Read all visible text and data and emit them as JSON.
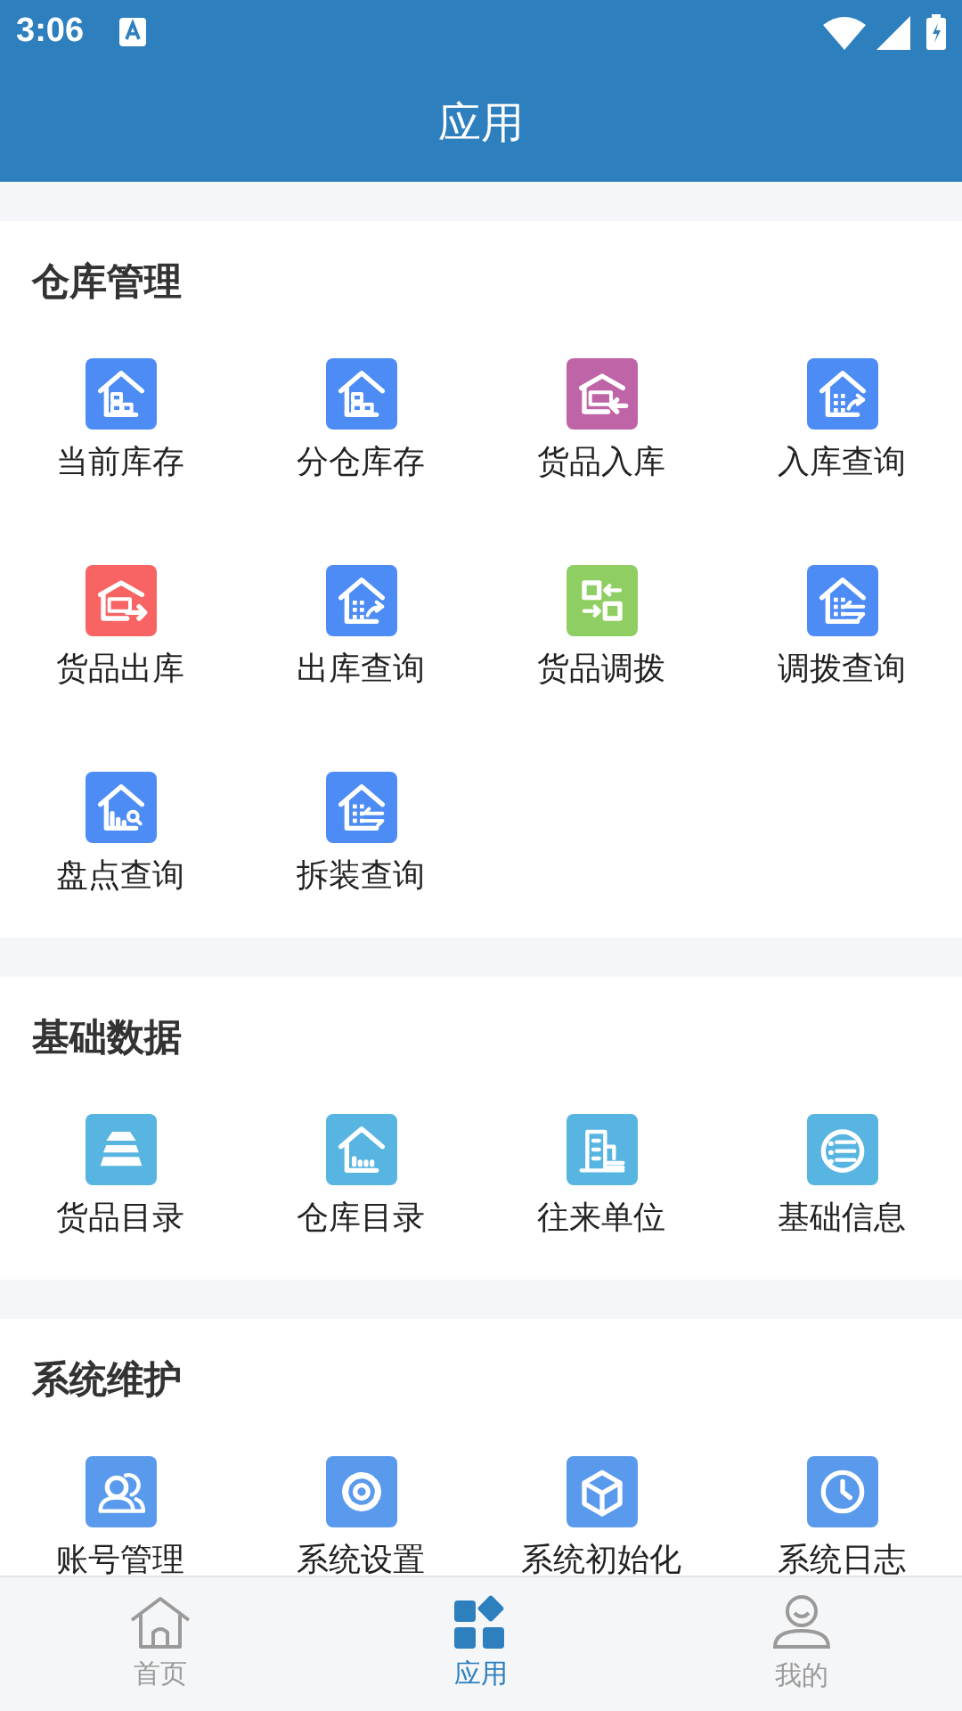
{
  "status_bar": {
    "time": "3:06"
  },
  "header": {
    "title": "应用"
  },
  "sections": [
    {
      "title": "仓库管理",
      "items": [
        {
          "label": "当前库存",
          "color": "#4d8cf5",
          "kind": "house-boxes"
        },
        {
          "label": "分仓库存",
          "color": "#4d8cf5",
          "kind": "house-boxes"
        },
        {
          "label": "货品入库",
          "color": "#bf64a6",
          "kind": "warehouse-in"
        },
        {
          "label": "入库查询",
          "color": "#4d8cf5",
          "kind": "house-grid-arrow"
        },
        {
          "label": "货品出库",
          "color": "#f86464",
          "kind": "warehouse-out"
        },
        {
          "label": "出库查询",
          "color": "#4d8cf5",
          "kind": "house-grid-arrow"
        },
        {
          "label": "货品调拨",
          "color": "#8fce62",
          "kind": "swap-squares"
        },
        {
          "label": "调拨查询",
          "color": "#4d8cf5",
          "kind": "house-swap"
        },
        {
          "label": "盘点查询",
          "color": "#4d8cf5",
          "kind": "house-search"
        },
        {
          "label": "拆装查询",
          "color": "#4d8cf5",
          "kind": "house-swap"
        }
      ]
    },
    {
      "title": "基础数据",
      "items": [
        {
          "label": "货品目录",
          "color": "#58b4e0",
          "kind": "layers"
        },
        {
          "label": "仓库目录",
          "color": "#58b4e0",
          "kind": "house-bars"
        },
        {
          "label": "往来单位",
          "color": "#58b4e0",
          "kind": "building"
        },
        {
          "label": "基础信息",
          "color": "#58b4e0",
          "kind": "list-circle"
        }
      ]
    },
    {
      "title": "系统维护",
      "items": [
        {
          "label": "账号管理",
          "color": "#5a9aec",
          "kind": "users"
        },
        {
          "label": "系统设置",
          "color": "#5a9aec",
          "kind": "gear"
        },
        {
          "label": "系统初始化",
          "color": "#5a9aec",
          "kind": "cube"
        },
        {
          "label": "系统日志",
          "color": "#5a9aec",
          "kind": "clock"
        }
      ]
    }
  ],
  "tabs": [
    {
      "label": "首页",
      "kind": "home",
      "selected": false
    },
    {
      "label": "应用",
      "kind": "apps",
      "selected": true
    },
    {
      "label": "我的",
      "kind": "user",
      "selected": false
    }
  ]
}
